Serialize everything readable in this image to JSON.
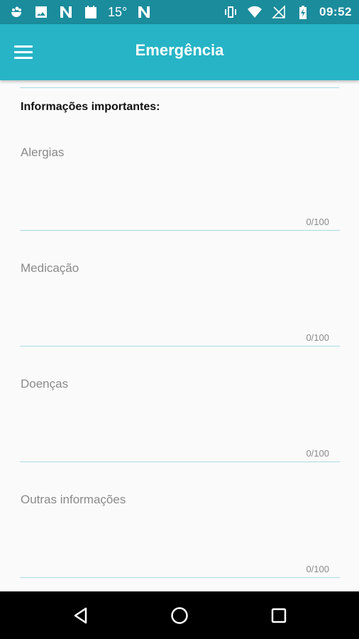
{
  "status_bar": {
    "left_icons": [
      "weather-icon",
      "image-icon",
      "n-app-icon",
      "calendar-icon",
      "temperature",
      "n-app-icon"
    ],
    "temperature": "15°",
    "right_icons": [
      "vibrate-icon",
      "wifi-icon",
      "no-signal-icon",
      "battery-charging-icon"
    ],
    "time": "09:52"
  },
  "app_bar": {
    "title": "Emergência",
    "menu_icon": "hamburger-menu-icon"
  },
  "section": {
    "title": "Informações importantes:"
  },
  "fields": [
    {
      "label": "Alergias",
      "value": "",
      "counter": "0/100"
    },
    {
      "label": "Medicação",
      "value": "",
      "counter": "0/100"
    },
    {
      "label": "Doenças",
      "value": "",
      "counter": "0/100"
    },
    {
      "label": "Outras informações",
      "value": "",
      "counter": "0/100"
    }
  ],
  "nav_bar": {
    "icons": [
      "back-icon",
      "home-icon",
      "recents-icon"
    ]
  },
  "colors": {
    "status_bar": "#1a8c9c",
    "app_bar": "#26b4c6",
    "underline": "#a8dbe2",
    "background": "#fafafa"
  }
}
